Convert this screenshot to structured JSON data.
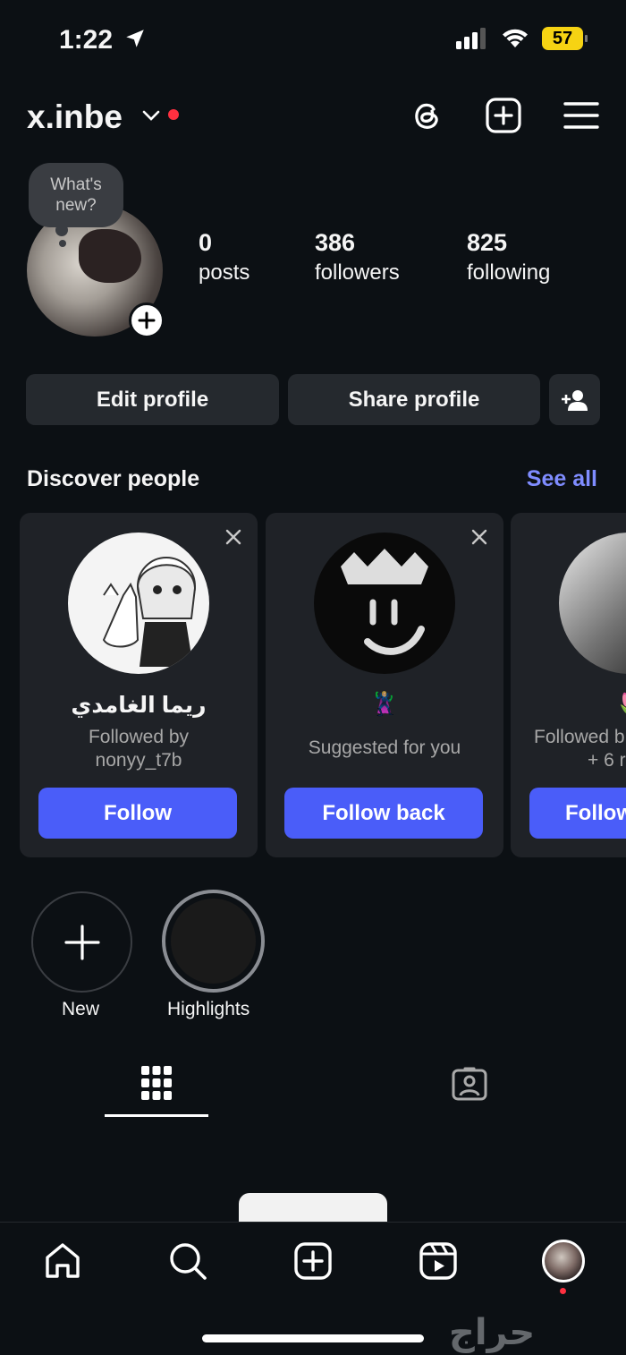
{
  "status_bar": {
    "time": "1:22",
    "battery": "57"
  },
  "header": {
    "username": "x.inbe"
  },
  "profile": {
    "note_bubble": "What's new?",
    "stats": [
      {
        "value": "0",
        "label": "posts"
      },
      {
        "value": "386",
        "label": "followers"
      },
      {
        "value": "825",
        "label": "following"
      }
    ]
  },
  "actions": {
    "edit_profile": "Edit profile",
    "share_profile": "Share profile"
  },
  "discover": {
    "title": "Discover people",
    "see_all": "See all",
    "cards": [
      {
        "name": "ريما الغامدي",
        "sub_line1": "Followed by",
        "sub_line2": "nonyy_t7b",
        "button": "Follow"
      },
      {
        "name": "🦹🏼‍♀️",
        "sub_line1": "Suggested for you",
        "sub_line2": "",
        "button": "Follow back"
      },
      {
        "name": "🌷",
        "sub_line1": "Followed b",
        "sub_line2": "+ 6 r",
        "button": "Follow"
      }
    ]
  },
  "highlights": {
    "new_label": "New",
    "highlight_label": "Highlights"
  },
  "watermark": "حراج",
  "colors": {
    "background": "#0c1014",
    "accent_blue": "#4a5df9",
    "link_blue": "#7f8cff",
    "notification_red": "#ff3040",
    "card_bg": "#1f2227"
  }
}
